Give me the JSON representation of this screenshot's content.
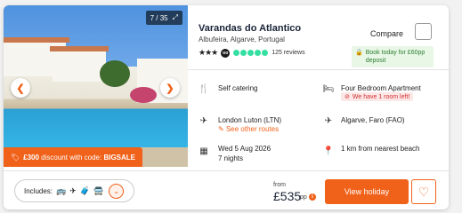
{
  "photo": {
    "counter": "7 / 35",
    "expand_icon": "expand-icon",
    "prev_icon": "chevron-left-icon",
    "next_icon": "chevron-right-icon"
  },
  "promo": {
    "amount": "£300",
    "text": " discount with code: ",
    "code": "BIGSALE"
  },
  "hotel": {
    "name": "Varandas do Atlantico",
    "location": "Albufeira, Algarve, Portugal",
    "stars": "★★★",
    "ta_rating": 5,
    "reviews": "125 reviews"
  },
  "compare": {
    "label": "Compare"
  },
  "deposit": {
    "text": "Book today for £60pp deposit"
  },
  "details": {
    "board": "Self catering",
    "room": "Four Bedroom Apartment",
    "room_alert": "We have 1 room left!",
    "departure": "London Luton (LTN)",
    "other_routes": "See other routes",
    "arrival": "Algarve, Faro (FAO)",
    "date": "Wed 5 Aug 2026",
    "nights": "7 nights",
    "distance": "1 km from nearest beach"
  },
  "bottom": {
    "includes_label": "Includes:",
    "from": "from",
    "price": "£535",
    "pp": "pp",
    "cta": "View holiday"
  },
  "colors": {
    "accent": "#f0611a",
    "ta_green": "#34e0a1"
  }
}
